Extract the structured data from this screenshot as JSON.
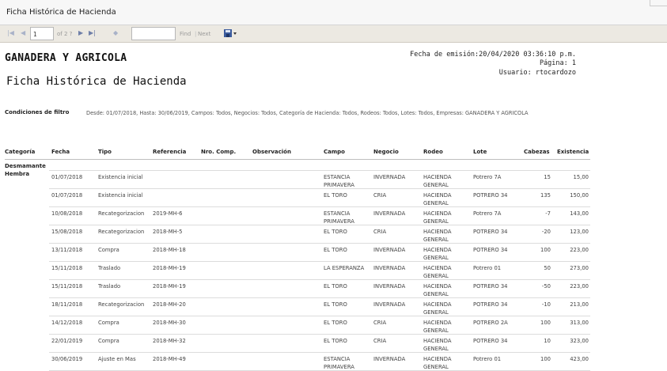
{
  "window": {
    "title": "Ficha Histórica de Hacienda"
  },
  "toolbar": {
    "first_icon": "first-page-icon",
    "prev_icon": "previous-page-icon",
    "page_value": "1",
    "of_pages": "of 2 ?",
    "next_icon": "next-page-icon",
    "last_icon": "last-page-icon",
    "back_icon": "back-icon",
    "find_value": "",
    "find_label": "Find",
    "separator": "|",
    "next_label": "Next",
    "export_icon": "export-save-icon"
  },
  "header": {
    "company": "GANADERA Y AGRICOLA",
    "title": "Ficha Histórica de Hacienda",
    "emission": "Fecha de emisión:20/04/2020 03:36:10 p.m.",
    "page": "Página: 1",
    "user": "Usuario: rtocardozo"
  },
  "filter": {
    "label": "Condiciones de filtro",
    "text": "Desde: 01/07/2018, Hasta: 30/06/2019, Campos: Todos, Negocios: Todos, Categoría de Hacienda: Todos, Rodeos: Todos, Lotes: Todos, Empresas: GANADERA Y AGRICOLA"
  },
  "columns": {
    "categoria": "Categoría",
    "fecha": "Fecha",
    "tipo": "Tipo",
    "referencia": "Referencia",
    "nro_comp": "Nro. Comp.",
    "observacion": "Observación",
    "campo": "Campo",
    "negocio": "Negocio",
    "rodeo": "Rodeo",
    "lote": "Lote",
    "cabezas": "Cabezas",
    "existencia": "Existencia"
  },
  "category": "Desmamante Hembra",
  "rows": [
    {
      "fecha": "01/07/2018",
      "tipo": "Existencia inicial",
      "referencia": "",
      "nro": "",
      "obs": "",
      "campo": "ESTANCIA PRIMAVERA",
      "negocio": "INVERNADA",
      "rodeo": "HACIENDA GENERAL",
      "lote": "Potrero 7A",
      "cabezas": "15",
      "existencia": "15,00"
    },
    {
      "fecha": "01/07/2018",
      "tipo": "Existencia inicial",
      "referencia": "",
      "nro": "",
      "obs": "",
      "campo": "EL TORO",
      "negocio": "CRIA",
      "rodeo": "HACIENDA GENERAL",
      "lote": "POTRERO 34",
      "cabezas": "135",
      "existencia": "150,00"
    },
    {
      "fecha": "10/08/2018",
      "tipo": "Recategorizacion",
      "referencia": "2019-MH-6",
      "nro": "",
      "obs": "",
      "campo": "ESTANCIA PRIMAVERA",
      "negocio": "INVERNADA",
      "rodeo": "HACIENDA GENERAL",
      "lote": "Potrero 7A",
      "cabezas": "-7",
      "existencia": "143,00"
    },
    {
      "fecha": "15/08/2018",
      "tipo": "Recategorizacion",
      "referencia": "2018-MH-5",
      "nro": "",
      "obs": "",
      "campo": "EL TORO",
      "negocio": "CRIA",
      "rodeo": "HACIENDA GENERAL",
      "lote": "POTRERO 34",
      "cabezas": "-20",
      "existencia": "123,00"
    },
    {
      "fecha": "13/11/2018",
      "tipo": "Compra",
      "referencia": "2018-MH-18",
      "nro": "",
      "obs": "",
      "campo": "EL TORO",
      "negocio": "INVERNADA",
      "rodeo": "HACIENDA GENERAL",
      "lote": "POTRERO 34",
      "cabezas": "100",
      "existencia": "223,00"
    },
    {
      "fecha": "15/11/2018",
      "tipo": "Traslado",
      "referencia": "2018-MH-19",
      "nro": "",
      "obs": "",
      "campo": "LA ESPERANZA",
      "negocio": "INVERNADA",
      "rodeo": "HACIENDA GENERAL",
      "lote": "Potrero 01",
      "cabezas": "50",
      "existencia": "273,00"
    },
    {
      "fecha": "15/11/2018",
      "tipo": "Traslado",
      "referencia": "2018-MH-19",
      "nro": "",
      "obs": "",
      "campo": "EL TORO",
      "negocio": "INVERNADA",
      "rodeo": "HACIENDA GENERAL",
      "lote": "POTRERO 34",
      "cabezas": "-50",
      "existencia": "223,00"
    },
    {
      "fecha": "18/11/2018",
      "tipo": "Recategorizacion",
      "referencia": "2018-MH-20",
      "nro": "",
      "obs": "",
      "campo": "EL TORO",
      "negocio": "INVERNADA",
      "rodeo": "HACIENDA GENERAL",
      "lote": "POTRERO 34",
      "cabezas": "-10",
      "existencia": "213,00"
    },
    {
      "fecha": "14/12/2018",
      "tipo": "Compra",
      "referencia": "2018-MH-30",
      "nro": "",
      "obs": "",
      "campo": "EL TORO",
      "negocio": "CRIA",
      "rodeo": "HACIENDA GENERAL",
      "lote": "POTRERO 2A",
      "cabezas": "100",
      "existencia": "313,00"
    },
    {
      "fecha": "22/01/2019",
      "tipo": "Compra",
      "referencia": "2018-MH-32",
      "nro": "",
      "obs": "",
      "campo": "EL TORO",
      "negocio": "CRIA",
      "rodeo": "HACIENDA GENERAL",
      "lote": "POTRERO 34",
      "cabezas": "10",
      "existencia": "323,00"
    },
    {
      "fecha": "30/06/2019",
      "tipo": "Ajuste en Mas",
      "referencia": "2018-MH-49",
      "nro": "",
      "obs": "",
      "campo": "ESTANCIA PRIMAVERA",
      "negocio": "INVERNADA",
      "rodeo": "HACIENDA GENERAL",
      "lote": "Potrero 01",
      "cabezas": "100",
      "existencia": "423,00"
    }
  ]
}
